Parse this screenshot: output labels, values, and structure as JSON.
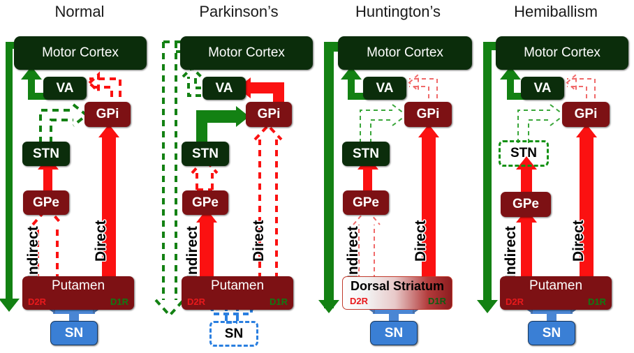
{
  "figure": {
    "type": "diagram",
    "subject": "Basal ganglia direct and indirect pathway circuit diagrams",
    "panel_count": 4
  },
  "panels": [
    {
      "id": "normal",
      "title": "Normal",
      "nodes": {
        "cortex": "Motor Cortex",
        "va": "VA",
        "gpi": "GPi",
        "stn": "STN",
        "gpe": "GPe",
        "striatum": "Putamen",
        "sn": "SN"
      },
      "receptors": {
        "d2": "D2R",
        "d1": "D1R"
      },
      "pathway_labels": {
        "indirect": "Indirect",
        "direct": "Direct"
      },
      "edges": [
        {
          "from": "cortex",
          "to": "striatum",
          "color": "#138113",
          "style": "solid",
          "weight": "normal"
        },
        {
          "from": "striatum",
          "to": "gpi",
          "color": "#fb1111",
          "style": "solid",
          "weight": "normal"
        },
        {
          "from": "striatum",
          "to": "gpe",
          "color": "#fb1111",
          "style": "dashed-outline",
          "weight": "normal"
        },
        {
          "from": "gpe",
          "to": "stn",
          "color": "#fb1111",
          "style": "solid",
          "weight": "normal"
        },
        {
          "from": "stn",
          "to": "gpi",
          "color": "#138113",
          "style": "dashed-outline",
          "weight": "normal"
        },
        {
          "from": "gpi",
          "to": "va",
          "color": "#fb1111",
          "style": "dashed-outline",
          "weight": "normal"
        },
        {
          "from": "va",
          "to": "cortex",
          "color": "#138113",
          "style": "solid",
          "weight": "normal"
        },
        {
          "from": "sn",
          "to": "striatum",
          "color": "#4a86d4",
          "style": "solid",
          "weight": "normal"
        }
      ]
    },
    {
      "id": "parkinsons",
      "title": "Parkinson’s",
      "nodes": {
        "cortex": "Motor Cortex",
        "va": "VA",
        "gpi": "GPi",
        "stn": "STN",
        "gpe": "GPe",
        "striatum": "Putamen",
        "sn": "SN"
      },
      "receptors": {
        "d2": "D2R",
        "d1": "D1R"
      },
      "pathway_labels": {
        "indirect": "Indirect",
        "direct": "Direct"
      },
      "lesioned": [
        "sn"
      ],
      "edges": [
        {
          "from": "cortex",
          "to": "striatum",
          "color": "#138113",
          "style": "dashed-outline",
          "weight": "reduced"
        },
        {
          "from": "striatum",
          "to": "gpi",
          "color": "#fb1111",
          "style": "dashed-outline",
          "weight": "reduced"
        },
        {
          "from": "striatum",
          "to": "gpe",
          "color": "#fb1111",
          "style": "solid",
          "weight": "increased"
        },
        {
          "from": "gpe",
          "to": "stn",
          "color": "#fb1111",
          "style": "dashed-outline",
          "weight": "reduced"
        },
        {
          "from": "stn",
          "to": "gpi",
          "color": "#138113",
          "style": "solid",
          "weight": "increased"
        },
        {
          "from": "gpi",
          "to": "va",
          "color": "#fb1111",
          "style": "solid",
          "weight": "increased"
        },
        {
          "from": "va",
          "to": "cortex",
          "color": "#138113",
          "style": "dashed-outline",
          "weight": "reduced"
        },
        {
          "from": "sn",
          "to": "striatum",
          "color": "#2a7fe0",
          "style": "dashed-outline",
          "weight": "lost"
        }
      ]
    },
    {
      "id": "huntingtons",
      "title": "Huntington’s",
      "nodes": {
        "cortex": "Motor Cortex",
        "va": "VA",
        "gpi": "GPi",
        "stn": "STN",
        "gpe": "GPe",
        "striatum": "Dorsal Striatum",
        "sn": "SN"
      },
      "receptors": {
        "d2": "D2R",
        "d1": "D1R"
      },
      "pathway_labels": {
        "indirect": "Indirect",
        "direct": "Direct"
      },
      "lesioned": [
        "striatum"
      ],
      "edges": [
        {
          "from": "cortex",
          "to": "striatum",
          "color": "#138113",
          "style": "solid",
          "weight": "increased"
        },
        {
          "from": "striatum",
          "to": "gpi",
          "color": "#fb1111",
          "style": "solid",
          "weight": "normal"
        },
        {
          "from": "striatum",
          "to": "gpe",
          "color": "#f06a6a",
          "style": "dashed-outline",
          "weight": "reduced"
        },
        {
          "from": "gpe",
          "to": "stn",
          "color": "#fb1111",
          "style": "solid",
          "weight": "normal"
        },
        {
          "from": "stn",
          "to": "gpi",
          "color": "#3aa63a",
          "style": "dashed-outline",
          "weight": "reduced"
        },
        {
          "from": "gpi",
          "to": "va",
          "color": "#f06a6a",
          "style": "dashed-outline",
          "weight": "reduced"
        },
        {
          "from": "va",
          "to": "cortex",
          "color": "#138113",
          "style": "solid",
          "weight": "normal"
        },
        {
          "from": "sn",
          "to": "striatum",
          "color": "#4a86d4",
          "style": "solid",
          "weight": "normal"
        }
      ]
    },
    {
      "id": "hemiballism",
      "title": "Hemiballism",
      "nodes": {
        "cortex": "Motor Cortex",
        "va": "VA",
        "gpi": "GPi",
        "stn": "STN",
        "gpe": "GPe",
        "striatum": "Putamen",
        "sn": "SN"
      },
      "receptors": {
        "d2": "D2R",
        "d1": "D1R"
      },
      "pathway_labels": {
        "indirect": "Indirect",
        "direct": "Direct"
      },
      "lesioned": [
        "stn"
      ],
      "edges": [
        {
          "from": "cortex",
          "to": "striatum",
          "color": "#138113",
          "style": "solid",
          "weight": "normal"
        },
        {
          "from": "striatum",
          "to": "gpi",
          "color": "#fb1111",
          "style": "solid",
          "weight": "normal"
        },
        {
          "from": "striatum",
          "to": "gpe",
          "color": "#fb1111",
          "style": "solid",
          "weight": "normal"
        },
        {
          "from": "gpe",
          "to": "stn",
          "color": "#fb1111",
          "style": "solid",
          "weight": "normal"
        },
        {
          "from": "stn",
          "to": "gpi",
          "color": "#3aa63a",
          "style": "dashed-outline",
          "weight": "reduced"
        },
        {
          "from": "gpi",
          "to": "va",
          "color": "#f06a6a",
          "style": "dashed-outline",
          "weight": "reduced"
        },
        {
          "from": "va",
          "to": "cortex",
          "color": "#138113",
          "style": "solid",
          "weight": "normal"
        },
        {
          "from": "sn",
          "to": "striatum",
          "color": "#4a86d4",
          "style": "solid",
          "weight": "normal"
        }
      ]
    }
  ],
  "colors": {
    "cortex_box": "#0b2d0b",
    "nucleus_box": "#7d1114",
    "sn_box": "#3a7fd5",
    "excitatory": "#138113",
    "inhibitory": "#fb1111",
    "dopamine": "#4a86d4",
    "d1_label": "#0f7a12",
    "d2_label": "#e8191c",
    "background": "#ffffff"
  }
}
